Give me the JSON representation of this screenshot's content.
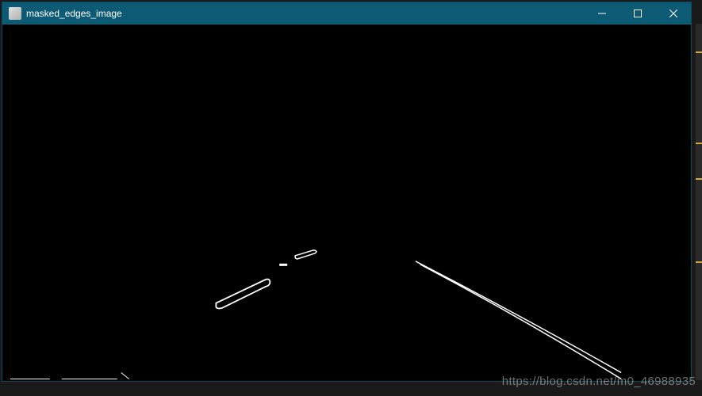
{
  "window": {
    "title": "masked_edges_image"
  },
  "watermark": {
    "text": "https://blog.csdn.net/m0_46988935"
  },
  "controls": {
    "minimize": "—",
    "maximize": "☐",
    "close": "✕"
  }
}
